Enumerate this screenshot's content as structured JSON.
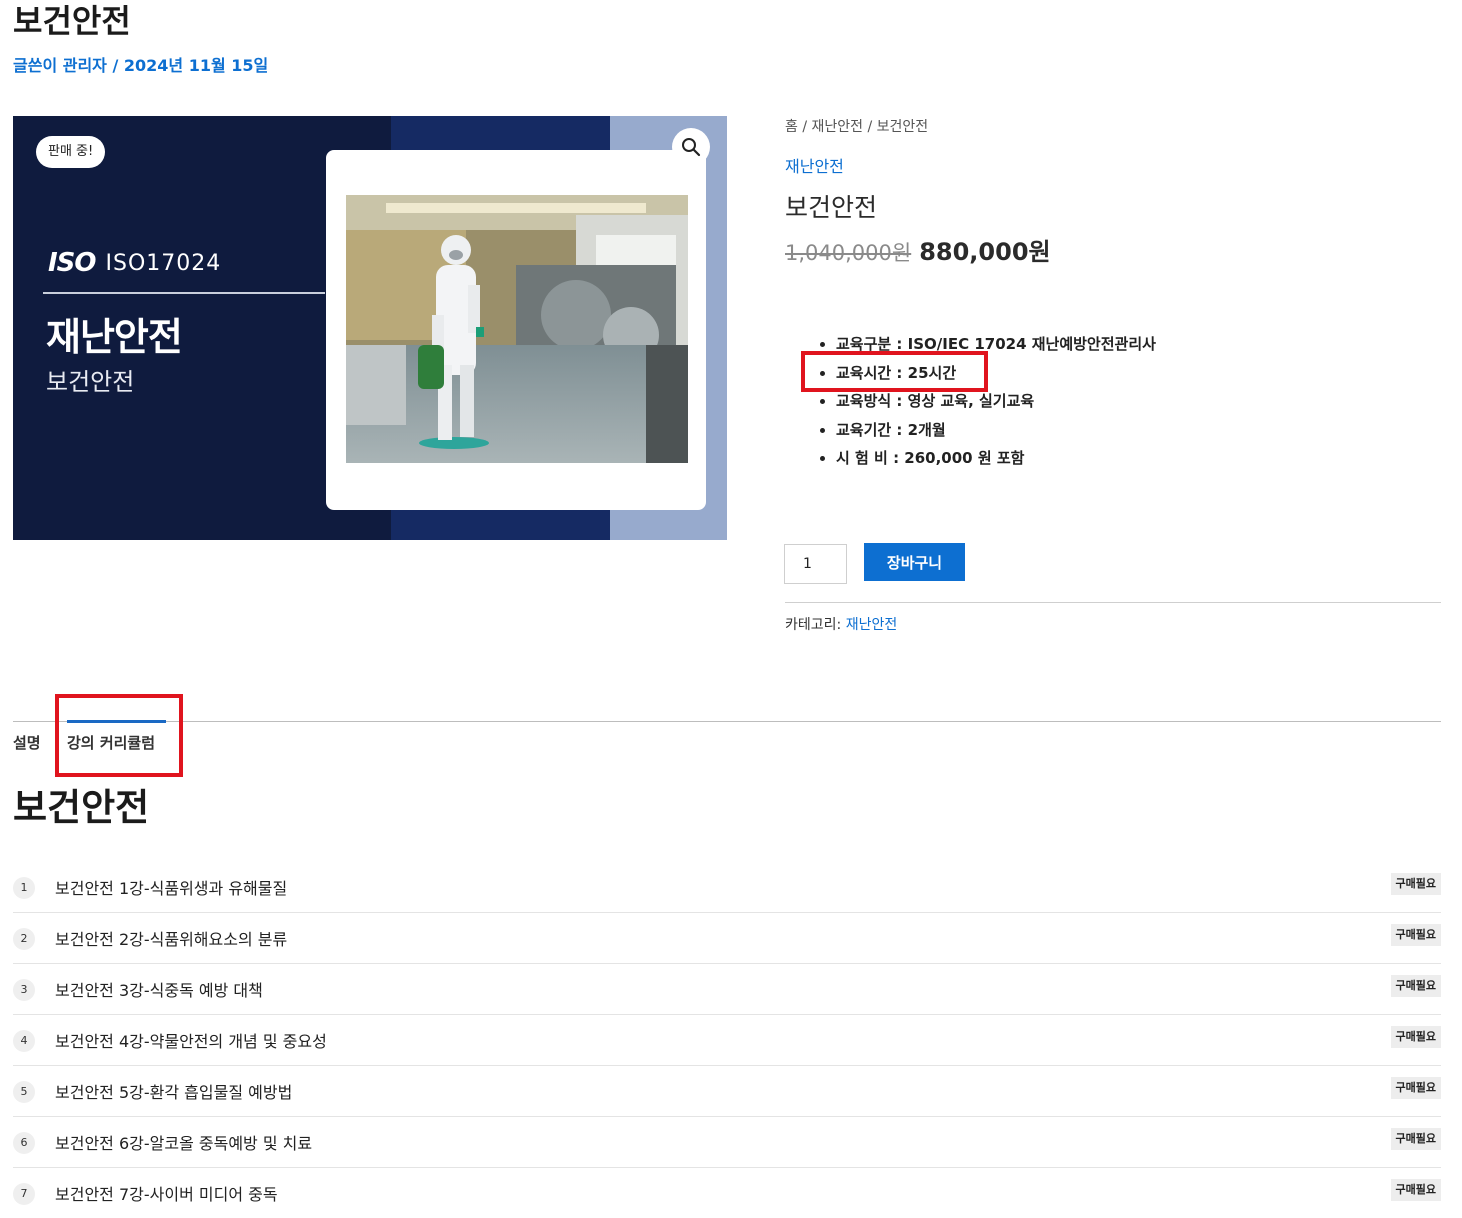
{
  "header": {
    "title": "보건안전",
    "meta": "글쓴이 관리자 / 2024년 11월 15일"
  },
  "image": {
    "sale_badge": "판매 중!",
    "iso_logo": "ISO",
    "iso_text": "ISO17024",
    "heading": "재난안전",
    "subheading": "보건안전",
    "zoom_icon": "search-icon"
  },
  "product": {
    "breadcrumb": "홈 / 재난안전 / 보건안전",
    "category": "재난안전",
    "title": "보건안전",
    "old_price": "1,040,000원",
    "new_price": "880,000원",
    "specs": [
      "교육구분 : ISO/IEC 17024 재난예방안전관리사",
      "교육시간 :  25시간",
      "교육방식 : 영상 교육, 실기교육",
      "교육기간 : 2개월",
      "시 험 비   :  260,000 원 포함"
    ],
    "quantity": "1",
    "cart_button": "장바구니",
    "category_label": "카테고리:",
    "category_value": "재난안전"
  },
  "tabs": [
    {
      "label": "설명"
    },
    {
      "label": "강의 커리큘럼"
    }
  ],
  "curriculum": {
    "title": "보건안전",
    "badge": "구매필요",
    "lessons": [
      {
        "num": "1",
        "title": "보건안전 1강-식품위생과 유해물질"
      },
      {
        "num": "2",
        "title": "보건안전 2강-식품위해요소의 분류"
      },
      {
        "num": "3",
        "title": "보건안전 3강-식중독 예방 대책"
      },
      {
        "num": "4",
        "title": "보건안전 4강-약물안전의 개념 및 중요성"
      },
      {
        "num": "5",
        "title": "보건안전 5강-환각 흡입물질 예방법"
      },
      {
        "num": "6",
        "title": "보건안전 6강-알코올 중독예방 및 치료"
      },
      {
        "num": "7",
        "title": "보건안전 7강-사이버 미디어 중독"
      }
    ]
  },
  "colors": {
    "accent": "#0d6fd1",
    "highlight": "#e0141e",
    "image_dark": "#0f1b3e",
    "image_navy": "#152a63",
    "image_light": "#97aacd"
  }
}
